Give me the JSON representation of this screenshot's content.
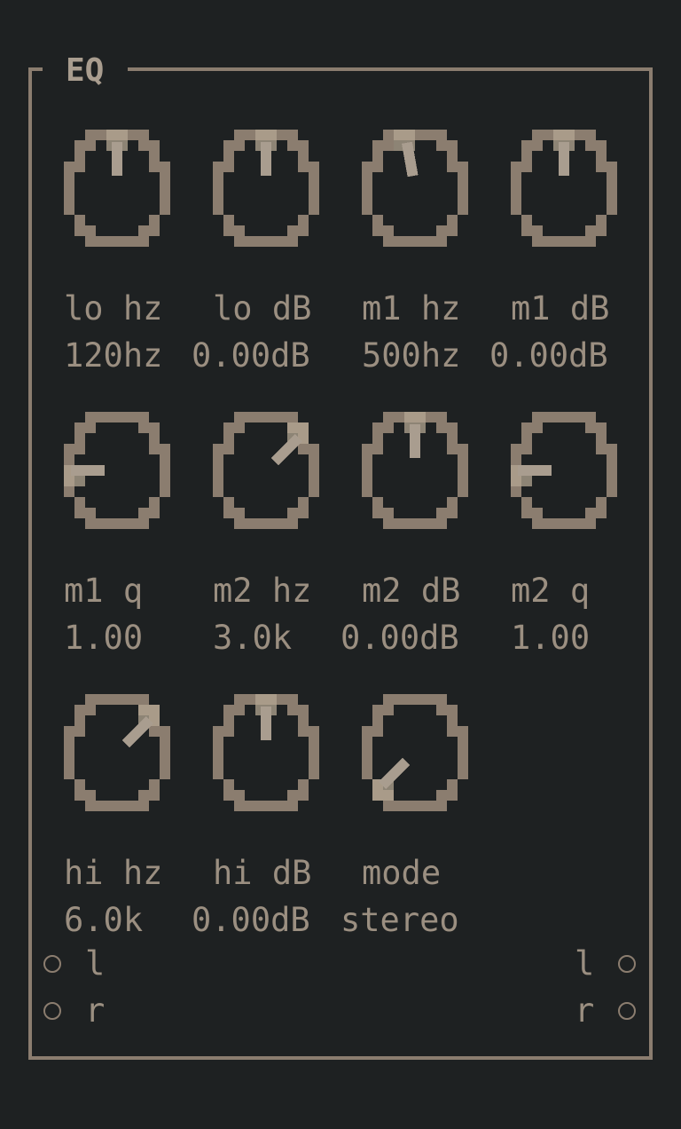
{
  "panel": {
    "title": "EQ"
  },
  "colors": {
    "background": "#1e2122",
    "frame": "#8b7d6f",
    "text": "#9b8f81",
    "knob_ring": "#8b7d6f",
    "knob_indicator": "#a99d8f",
    "knob_highlight": "#b3a591"
  },
  "knobs": [
    {
      "label": "lo hz",
      "value": "120hz",
      "angle_deg": 0
    },
    {
      "label": "lo dB",
      "value": "0.00dB",
      "angle_deg": 0
    },
    {
      "label": "m1 hz",
      "value": "500hz",
      "angle_deg": -10
    },
    {
      "label": "m1 dB",
      "value": "0.00dB",
      "angle_deg": 0
    },
    {
      "label": "m1 q",
      "value": "1.00",
      "angle_deg": -90
    },
    {
      "label": "m2 hz",
      "value": "3.0k",
      "angle_deg": 45
    },
    {
      "label": "m2 dB",
      "value": "0.00dB",
      "angle_deg": 0
    },
    {
      "label": "m2 q",
      "value": "1.00",
      "angle_deg": -90
    },
    {
      "label": "hi hz",
      "value": "6.0k",
      "angle_deg": 45
    },
    {
      "label": "hi dB",
      "value": "0.00dB",
      "angle_deg": 0
    },
    {
      "label": "mode",
      "value": "stereo",
      "angle_deg": -135
    }
  ],
  "inputs": [
    {
      "label": "l"
    },
    {
      "label": "r"
    }
  ],
  "outputs": [
    {
      "label": "l"
    },
    {
      "label": "r"
    }
  ]
}
